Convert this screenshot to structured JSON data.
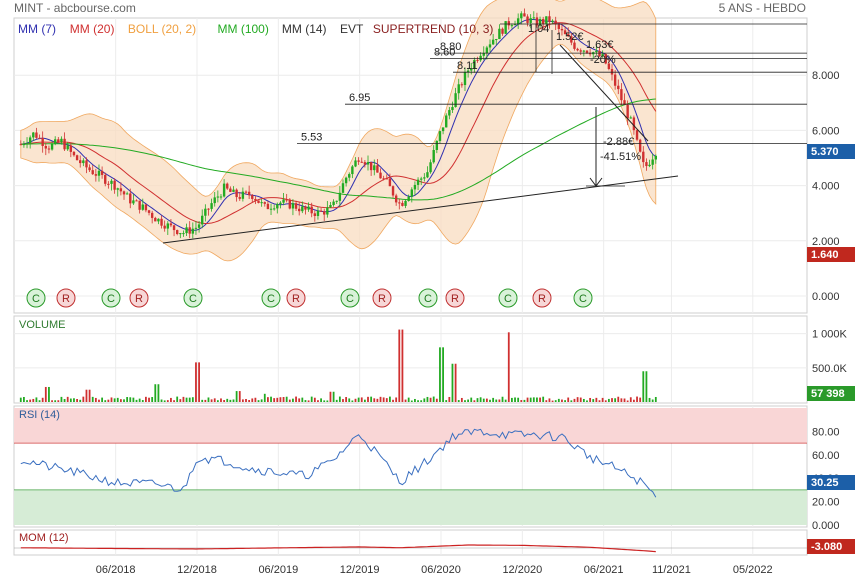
{
  "header": {
    "title": "MINT - abcbourse.com",
    "period": "5 ANS - HEBDO"
  },
  "colors": {
    "background": "#ffffff",
    "bollinger_band_fill": "#f8dcc0",
    "bollinger_band_line": "#f0a860",
    "mm7": "#3030b0",
    "mm20": "#d03030",
    "mm100": "#22aa22",
    "candle_up": "#22aa22",
    "candle_down": "#d03030",
    "rsi_line": "#3a6fc0",
    "rsi_overbought_zone": "#f9d6d6",
    "rsi_oversold_zone": "#d6ecd6",
    "mom_line": "#cc2222",
    "last_price_badge": "#1c5fa8",
    "min_price_badge": "#c0281e",
    "last_volume_badge": "#2a9a2a",
    "last_rsi_badge": "#1c5fa8",
    "last_mom_badge": "#c0281e"
  },
  "chart_data": {
    "type": "candlestick",
    "title": "MINT - abcbourse.com",
    "period": "5 ANS - HEBDO",
    "legend": [
      {
        "label": "MM (7)",
        "color": "#3030b0"
      },
      {
        "label": "MM (20)",
        "color": "#d03030"
      },
      {
        "label": "BOLL (20, 2)",
        "color": "#f0a040"
      },
      {
        "label": "MM (100)",
        "color": "#22aa22"
      },
      {
        "label": "MM (14)",
        "color": "#333333"
      },
      {
        "label": "EVT",
        "color": "#333333"
      },
      {
        "label": "SUPERTREND (10, 3)",
        "color": "#8a2020"
      }
    ],
    "x_tick_labels": [
      "06/2018",
      "12/2018",
      "06/2019",
      "12/2019",
      "06/2020",
      "12/2020",
      "06/2021",
      "11/2021",
      "05/2022"
    ],
    "price_axis": {
      "ticks": [
        "0.000",
        "2.000",
        "4.000",
        "6.000",
        "8.000"
      ],
      "ylim": [
        0,
        10
      ]
    },
    "price_polyline": [
      [
        "2017-11",
        5.5
      ],
      [
        "2017-12",
        5.9
      ],
      [
        "2018-01",
        5.4
      ],
      [
        "2018-02",
        5.6
      ],
      [
        "2018-03",
        5.0
      ],
      [
        "2018-04",
        4.6
      ],
      [
        "2018-05",
        4.3
      ],
      [
        "2018-06",
        4.0
      ],
      [
        "2018-07",
        3.5
      ],
      [
        "2018-08",
        3.2
      ],
      [
        "2018-09",
        2.8
      ],
      [
        "2018-10",
        2.5
      ],
      [
        "2018-11",
        2.3
      ],
      [
        "2018-12",
        2.5
      ],
      [
        "2019-01",
        3.3
      ],
      [
        "2019-02",
        3.9
      ],
      [
        "2019-03",
        3.6
      ],
      [
        "2019-04",
        3.7
      ],
      [
        "2019-05",
        3.2
      ],
      [
        "2019-06",
        3.4
      ],
      [
        "2019-07",
        3.3
      ],
      [
        "2019-08",
        3.1
      ],
      [
        "2019-09",
        3.0
      ],
      [
        "2019-10",
        3.2
      ],
      [
        "2019-11",
        4.3
      ],
      [
        "2019-12",
        5.1
      ],
      [
        "2020-01",
        4.6
      ],
      [
        "2020-02",
        4.1
      ],
      [
        "2020-03",
        3.3
      ],
      [
        "2020-04",
        4.0
      ],
      [
        "2020-05",
        4.5
      ],
      [
        "2020-06",
        6.0
      ],
      [
        "2020-07",
        7.2
      ],
      [
        "2020-08",
        8.2
      ],
      [
        "2020-09",
        8.9
      ],
      [
        "2020-10",
        9.4
      ],
      [
        "2020-11",
        9.9
      ],
      [
        "2020-12",
        10.1
      ],
      [
        "2021-01",
        9.9
      ],
      [
        "2021-02",
        10.0
      ],
      [
        "2021-03",
        9.5
      ],
      [
        "2021-04",
        9.0
      ],
      [
        "2021-05",
        8.9
      ],
      [
        "2021-06",
        8.6
      ],
      [
        "2021-07",
        7.5
      ],
      [
        "2021-08",
        6.3
      ],
      [
        "2021-09",
        4.6
      ],
      [
        "2021-10",
        5.37
      ]
    ],
    "last_price": "5.370",
    "min_price": "1.640",
    "price_level_lines": [
      {
        "label": "5.53",
        "value": 5.53
      },
      {
        "label": "6.95",
        "value": 6.95
      },
      {
        "label": "8.11",
        "value": 8.11
      },
      {
        "label": "8.60",
        "value": 8.6
      },
      {
        "label": "8.80",
        "value": 8.8
      }
    ],
    "drawdown_annotation": {
      "amount": "-2.88€",
      "percent": "-41.51%"
    },
    "overlapping_annotation_fragments": [
      "1.04",
      "1.52€",
      "1.63€",
      "-20%"
    ],
    "event_markers": [
      "C",
      "R",
      "C",
      "R",
      "C",
      "C",
      "R",
      "C",
      "R",
      "C",
      "R",
      "C",
      "R",
      "C"
    ],
    "volume": {
      "label": "VOLUME",
      "ticks": [
        "1 000K",
        "500.0K"
      ],
      "last": "57 398",
      "spikes": [
        [
          "2018-01",
          220000
        ],
        [
          "2018-04",
          180000
        ],
        [
          "2018-09",
          260000
        ],
        [
          "2018-12",
          580000
        ],
        [
          "2019-03",
          160000
        ],
        [
          "2019-05",
          120000
        ],
        [
          "2019-10",
          150000
        ],
        [
          "2020-03",
          1060000
        ],
        [
          "2020-06",
          800000
        ],
        [
          "2020-07",
          560000
        ],
        [
          "2020-11",
          1020000
        ],
        [
          "2021-09",
          450000
        ]
      ]
    },
    "rsi": {
      "label": "RSI (14)",
      "ticks": [
        "0.000",
        "20.00",
        "40.00",
        "60.00",
        "80.00"
      ],
      "ylim": [
        0,
        100
      ],
      "overbought": 70,
      "oversold": 30,
      "last": "30.25",
      "values": [
        [
          "2017-11",
          56
        ],
        [
          "2018-01",
          50
        ],
        [
          "2018-03",
          45
        ],
        [
          "2018-06",
          36
        ],
        [
          "2018-09",
          35
        ],
        [
          "2018-11",
          30
        ],
        [
          "2018-12",
          58
        ],
        [
          "2019-02",
          55
        ],
        [
          "2019-04",
          48
        ],
        [
          "2019-06",
          45
        ],
        [
          "2019-08",
          42
        ],
        [
          "2019-10",
          55
        ],
        [
          "2019-12",
          78
        ],
        [
          "2020-01",
          65
        ],
        [
          "2020-03",
          37
        ],
        [
          "2020-05",
          55
        ],
        [
          "2020-07",
          77
        ],
        [
          "2020-09",
          80
        ],
        [
          "2020-11",
          77
        ],
        [
          "2021-01",
          77
        ],
        [
          "2021-03",
          75
        ],
        [
          "2021-05",
          58
        ],
        [
          "2021-07",
          48
        ],
        [
          "2021-09",
          35
        ],
        [
          "2021-10",
          22
        ],
        [
          "2021-10",
          30
        ]
      ]
    },
    "momentum": {
      "label": "MOM (12)",
      "last": "-3.080",
      "values": [
        [
          "2017-11",
          0.2
        ],
        [
          "2018-06",
          -0.4
        ],
        [
          "2018-12",
          -0.8
        ],
        [
          "2019-06",
          0.1
        ],
        [
          "2019-12",
          0.9
        ],
        [
          "2020-03",
          0.2
        ],
        [
          "2020-08",
          2.5
        ],
        [
          "2020-12",
          2.2
        ],
        [
          "2021-05",
          0.6
        ],
        [
          "2021-08",
          -1.6
        ],
        [
          "2021-10",
          -3.08
        ]
      ]
    }
  }
}
